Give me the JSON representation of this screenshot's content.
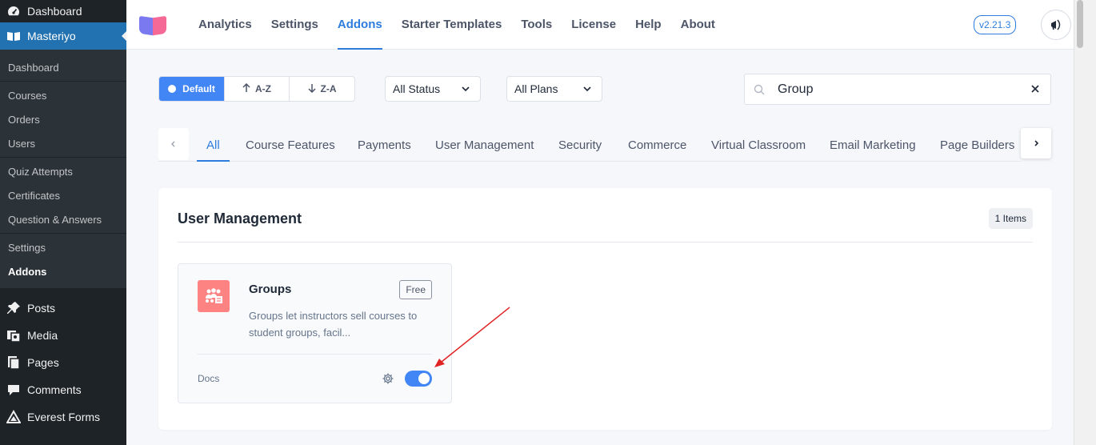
{
  "wp_sidebar": {
    "top_item": "Dashboard",
    "current_menu": "Masteriyo",
    "submenu": [
      "Dashboard",
      "Courses",
      "Orders",
      "Users",
      "Quiz Attempts",
      "Certificates",
      "Question & Answers",
      "Settings",
      "Addons"
    ],
    "menu": [
      "Posts",
      "Media",
      "Pages",
      "Comments",
      "Everest Forms"
    ]
  },
  "topbar": {
    "nav": [
      "Analytics",
      "Settings",
      "Addons",
      "Starter Templates",
      "Tools",
      "License",
      "Help",
      "About"
    ],
    "active_nav": "Addons",
    "version": "v2.21.3"
  },
  "filters": {
    "sort": [
      "Default",
      "A-Z",
      "Z-A"
    ],
    "status": "All Status",
    "plans": "All Plans"
  },
  "search": {
    "value": "Group"
  },
  "tabs": [
    "All",
    "Course Features",
    "Payments",
    "User Management",
    "Security",
    "Commerce",
    "Virtual Classroom",
    "Email Marketing",
    "Page Builders"
  ],
  "section": {
    "title": "User Management",
    "count": "1 Items"
  },
  "addon": {
    "name": "Groups",
    "plan": "Free",
    "description": "Groups let instructors sell courses to student groups, facil...",
    "docs": "Docs",
    "enabled": true
  },
  "colors": {
    "accent": "#2d7cde",
    "toggle": "#4285f4",
    "wp_active": "#2271b1",
    "addon_icon_bg": "#fd8383",
    "annotation_arrow": "#e02424"
  }
}
